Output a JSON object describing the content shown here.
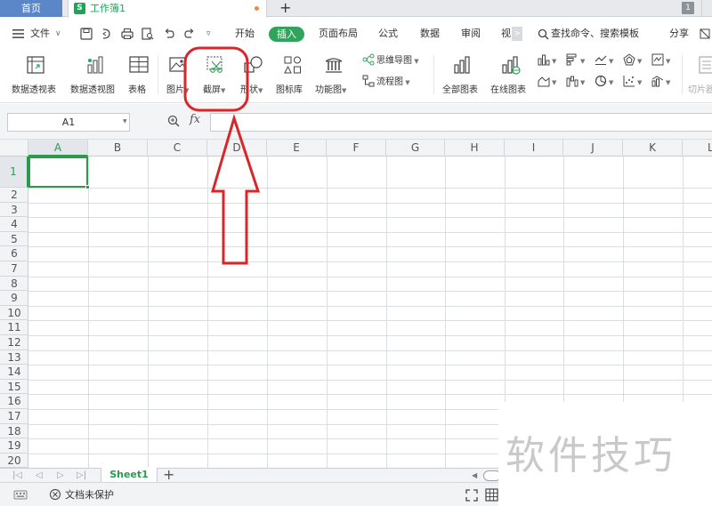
{
  "tabs": {
    "home": "首页",
    "document_icon": "S",
    "document": "工作簿1",
    "new_tab": "+",
    "window_count": "1"
  },
  "menu": {
    "file": "文件",
    "items": [
      "开始",
      "插入",
      "页面布局",
      "公式",
      "数据",
      "审阅",
      "视"
    ],
    "more": ">",
    "search": "查找命令、搜索模板",
    "share": "分享"
  },
  "ribbon": {
    "pivot_table": "数据透视表",
    "pivot_chart": "数据透视图",
    "table": "表格",
    "picture": "图片",
    "screenshot": "截屏",
    "shapes": "形状",
    "icon_library": "图标库",
    "function_chart": "功能图",
    "mind_map": "思维导图",
    "flowchart": "流程图",
    "all_charts": "全部图表",
    "online_charts": "在线图表",
    "slicer": "切片器"
  },
  "formula_bar": {
    "name_box": "A1",
    "fx": "fx",
    "formula": ""
  },
  "grid": {
    "columns": [
      "A",
      "B",
      "C",
      "D",
      "E",
      "F",
      "G",
      "H",
      "I",
      "J",
      "K",
      "L"
    ],
    "rows": [
      "1",
      "2",
      "3",
      "4",
      "5",
      "6",
      "7",
      "8",
      "9",
      "10",
      "11",
      "12",
      "13",
      "14",
      "15",
      "16",
      "17",
      "18",
      "19",
      "20"
    ],
    "selected_cell": "A1"
  },
  "sheets": {
    "active": "Sheet1",
    "add": "+"
  },
  "status": {
    "protection": "文档未保护"
  },
  "watermark": "软件技巧",
  "colors": {
    "accent_green": "#2ea55a",
    "home_tab_blue": "#5b87c9",
    "annotation_red": "#d9262b"
  }
}
